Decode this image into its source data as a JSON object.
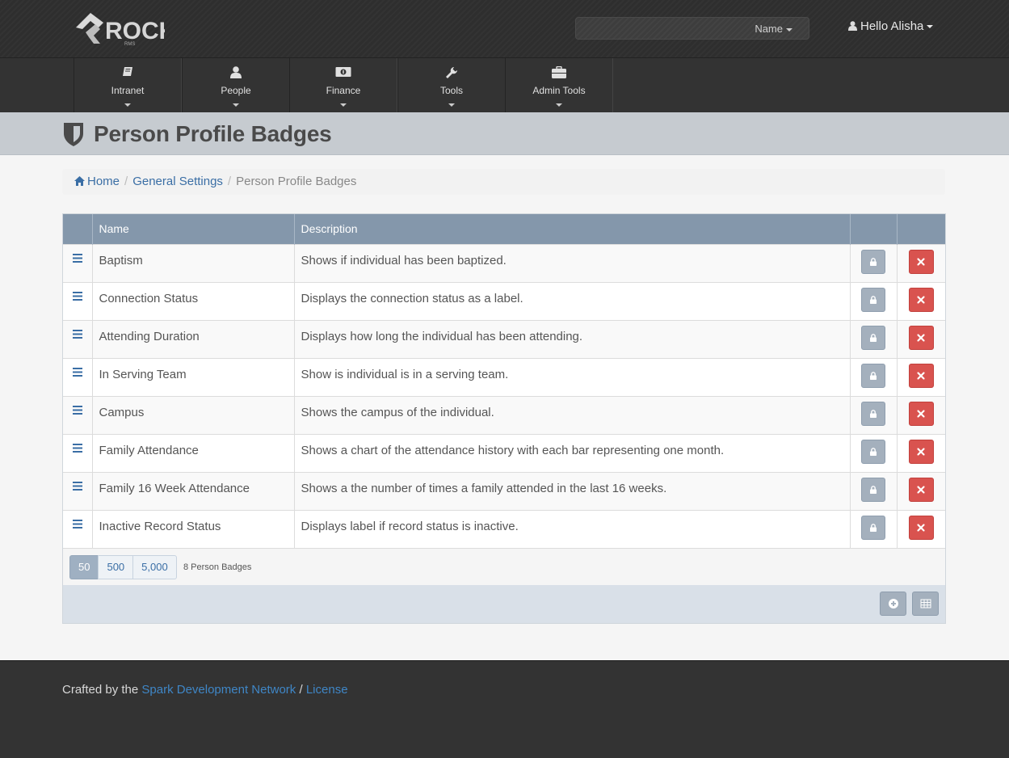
{
  "header": {
    "logo_text": "ROCK",
    "logo_subtext": "RMS",
    "search": {
      "type_label": "Name",
      "placeholder": ""
    },
    "user_greeting": "Hello Alisha"
  },
  "nav": {
    "items": [
      {
        "label": "Intranet",
        "icon": "book-icon"
      },
      {
        "label": "People",
        "icon": "user-icon"
      },
      {
        "label": "Finance",
        "icon": "money-icon"
      },
      {
        "label": "Tools",
        "icon": "wrench-icon"
      },
      {
        "label": "Admin Tools",
        "icon": "briefcase-icon"
      }
    ]
  },
  "page": {
    "title": "Person Profile Badges",
    "icon": "shield-icon"
  },
  "breadcrumb": {
    "items": [
      "Home",
      "General Settings",
      "Person Profile Badges"
    ]
  },
  "grid": {
    "columns": [
      "",
      "Name",
      "Description",
      "",
      ""
    ],
    "rows": [
      {
        "name": "Baptism",
        "description": "Shows if individual has been baptized."
      },
      {
        "name": "Connection Status",
        "description": "Displays the connection status as a label."
      },
      {
        "name": "Attending Duration",
        "description": "Displays how long the individual has been attending."
      },
      {
        "name": "In Serving Team",
        "description": "Show is individual is in a serving team."
      },
      {
        "name": "Campus",
        "description": "Shows the campus of the individual."
      },
      {
        "name": "Family Attendance",
        "description": "Shows a chart of the attendance history with each bar representing one month."
      },
      {
        "name": "Family 16 Week Attendance",
        "description": "Shows a the number of times a family attended in the last 16 weeks."
      },
      {
        "name": "Inactive Record Status",
        "description": "Displays label if record status is inactive."
      }
    ],
    "page_sizes": [
      "50",
      "500",
      "5,000"
    ],
    "active_page_size": "50",
    "item_count": "8 Person Badges"
  },
  "footer": {
    "prefix": "Crafted by the",
    "link1": "Spark Development Network",
    "separator": "/",
    "link2": "License"
  },
  "colors": {
    "header_bg": "#2e2e2e",
    "grid_header": "#8497ab",
    "delete": "#d9534f",
    "link": "#3a6ea5"
  }
}
